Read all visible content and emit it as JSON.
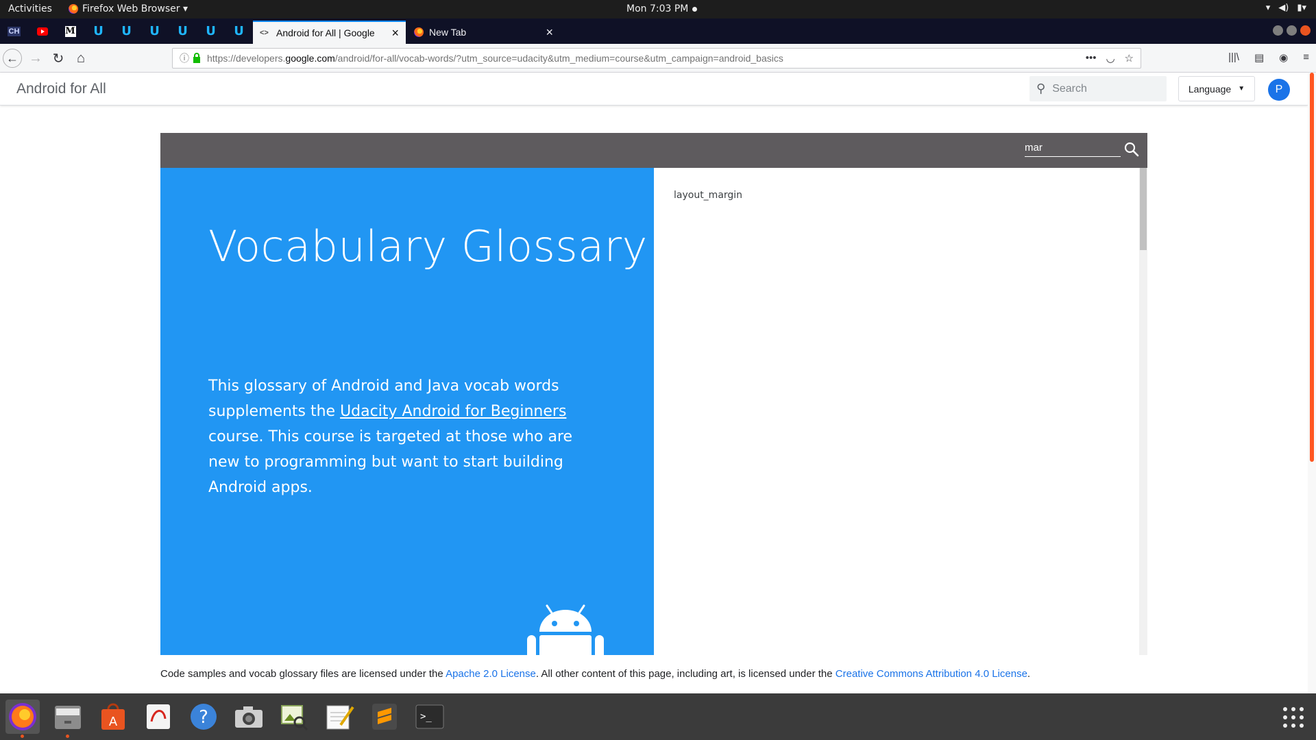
{
  "topbar": {
    "activities": "Activities",
    "app_menu": "Firefox Web Browser ▾",
    "clock": "Mon  7:03 PM"
  },
  "tabs": [
    {
      "label": "Android for All | Google",
      "active": true
    },
    {
      "label": "New Tab",
      "active": false
    }
  ],
  "pinned_tabs": [
    "CH",
    "youtube",
    "M",
    "udacity",
    "udacity",
    "udacity",
    "udacity",
    "udacity",
    "udacity"
  ],
  "url": {
    "prefix": "https://developers.",
    "host": "google.com",
    "path": "/android/for-all/vocab-words/?utm_source=udacity&utm_medium=course&utm_campaign=android_basics"
  },
  "site": {
    "title": "Android for All",
    "search_placeholder": "Search",
    "language_label": "Language",
    "avatar_initial": "P"
  },
  "glossary": {
    "search_value": "mar",
    "heading": "Vocabulary Glossary",
    "desc_before": "This glossary of Android and Java vocab words supplements the ",
    "desc_link": "Udacity Android for Beginners",
    "desc_after": " course. This course is targeted at those who are new to programming but want to start building Android apps.",
    "results": [
      "layout_margin"
    ]
  },
  "footer": {
    "text_a": "Code samples and vocab glossary files are licensed under the ",
    "link_a": "Apache 2.0 License",
    "text_b": ". All other content of this page, including art, is licensed under the ",
    "link_b": "Creative Commons Attribution 4.0 License",
    "text_c": "."
  },
  "dock_apps": [
    "firefox-icon",
    "files-icon",
    "software-center-icon",
    "document-viewer-icon",
    "help-icon",
    "screenshot-icon",
    "image-viewer-icon",
    "text-editor-icon",
    "sublime-text-icon",
    "terminal-icon"
  ],
  "colors": {
    "hero_blue": "#2196f3",
    "toolbar_gray": "#5e5b5e",
    "ubuntu_orange": "#e95420",
    "link_blue": "#1a73e8"
  }
}
